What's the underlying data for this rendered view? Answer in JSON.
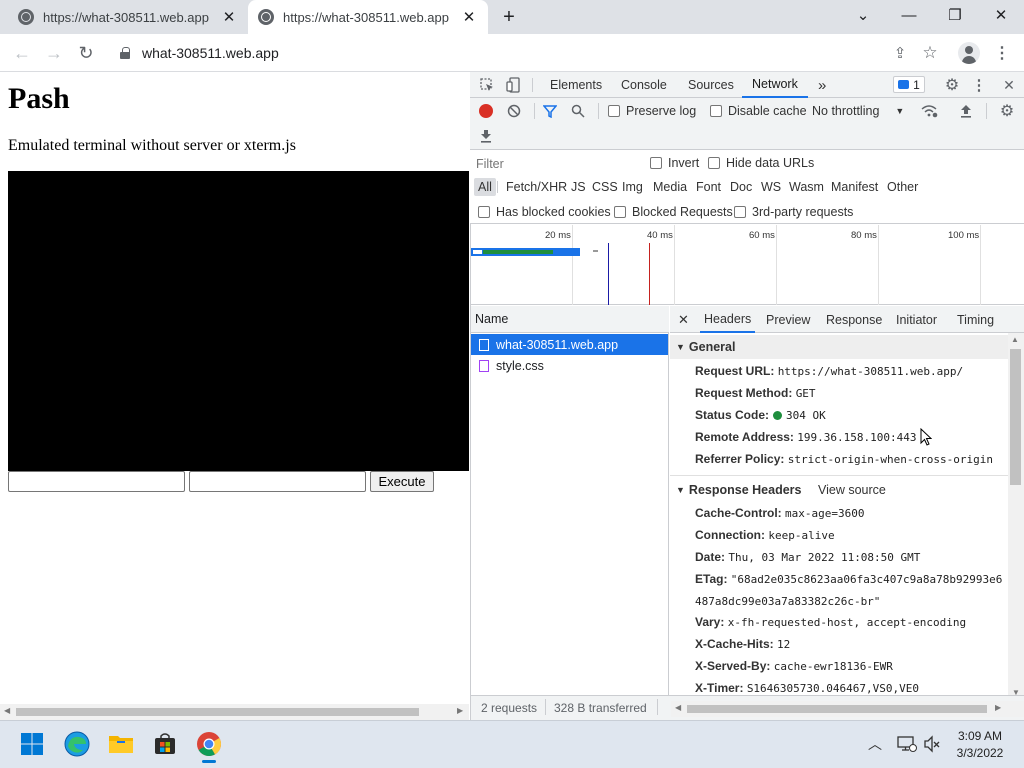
{
  "browser": {
    "tabs": [
      {
        "title": "https://what-308511.web.app",
        "active": false
      },
      {
        "title": "https://what-308511.web.app",
        "active": true
      }
    ],
    "new_tab_symbol": "+",
    "url": "what-308511.web.app",
    "window_controls": {
      "chevron": "⌄",
      "minimize": "—",
      "restore": "❐",
      "close": "✕"
    }
  },
  "page": {
    "heading": "Pash",
    "subtitle": "Emulated terminal without server or xterm.js",
    "terminal_color": "#000000",
    "input1_value": "",
    "input2_value": "",
    "execute_label": "Execute"
  },
  "devtools": {
    "tabs": [
      "Elements",
      "Console",
      "Sources",
      "Network"
    ],
    "active_tab": "Network",
    "more_tabs": "»",
    "issues_count": "1",
    "preserve_log": "Preserve log",
    "disable_cache": "Disable cache",
    "throttling": "No throttling",
    "filter_placeholder": "Filter",
    "invert": "Invert",
    "hide_data_urls": "Hide data URLs",
    "type_filters": [
      "All",
      "Fetch/XHR",
      "JS",
      "CSS",
      "Img",
      "Media",
      "Font",
      "Doc",
      "WS",
      "Wasm",
      "Manifest",
      "Other"
    ],
    "selected_type": "All",
    "blocked_cookies": "Has blocked cookies",
    "blocked_requests": "Blocked Requests",
    "third_party": "3rd-party requests",
    "timeline_ticks": [
      "20 ms",
      "40 ms",
      "60 ms",
      "80 ms",
      "100 ms"
    ],
    "name_header": "Name",
    "requests": [
      {
        "name": "what-308511.web.app",
        "selected": true
      },
      {
        "name": "style.css",
        "selected": false
      }
    ],
    "status": {
      "requests": "2 requests",
      "transferred": "328 B transferred"
    },
    "detail_tabs": [
      "Headers",
      "Preview",
      "Response",
      "Initiator",
      "Timing"
    ],
    "active_detail_tab": "Headers",
    "general": {
      "title": "General",
      "request_url_key": "Request URL:",
      "request_url": "https://what-308511.web.app/",
      "request_method_key": "Request Method:",
      "request_method": "GET",
      "status_code_key": "Status Code:",
      "status_code": "304 OK",
      "status_color": "#1e8e3e",
      "remote_address_key": "Remote Address:",
      "remote_address": "199.36.158.100:443",
      "referrer_policy_key": "Referrer Policy:",
      "referrer_policy": "strict-origin-when-cross-origin"
    },
    "response_headers": {
      "title": "Response Headers",
      "view_source": "View source",
      "items": [
        {
          "k": "Cache-Control:",
          "v": "max-age=3600"
        },
        {
          "k": "Connection:",
          "v": "keep-alive"
        },
        {
          "k": "Date:",
          "v": "Thu, 03 Mar 2022 11:08:50 GMT"
        },
        {
          "k": "ETag:",
          "v": "\"68ad2e035c8623aa06fa3c407c9a8a78b92993e6"
        },
        {
          "k": "",
          "v": "487a8dc99e03a7a83382c26c-br\""
        },
        {
          "k": "Vary:",
          "v": "x-fh-requested-host, accept-encoding"
        },
        {
          "k": "X-Cache-Hits:",
          "v": "12"
        },
        {
          "k": "X-Served-By:",
          "v": "cache-ewr18136-EWR"
        },
        {
          "k": "X-Timer:",
          "v": "S1646305730.046467,VS0,VE0"
        }
      ]
    }
  },
  "taskbar": {
    "time": "3:09 AM",
    "date": "3/3/2022",
    "apps": [
      "windows-start",
      "edge",
      "file-explorer",
      "microsoft-store",
      "chrome"
    ]
  },
  "colors": {
    "accent": "#1a73e8",
    "record_red": "#d93025",
    "taskbar_bg": "#dfe6ef"
  }
}
